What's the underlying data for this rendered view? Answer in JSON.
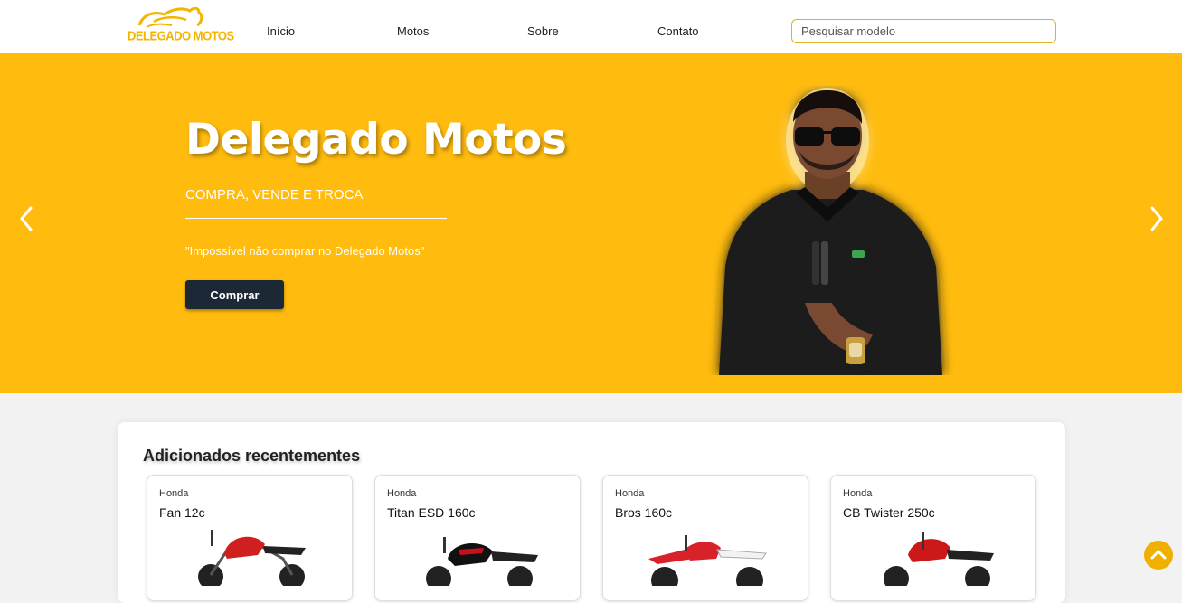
{
  "brand": {
    "logo_text": "DELEGADO MOTOS",
    "accent": "#ffbb0e",
    "dark": "#1d2837"
  },
  "nav": {
    "items": [
      {
        "label": "Início"
      },
      {
        "label": "Motos"
      },
      {
        "label": "Sobre"
      },
      {
        "label": "Contato"
      }
    ],
    "search_placeholder": "Pesquisar modelo"
  },
  "hero": {
    "title": "Delegado Motos",
    "subtitle": "COMPRA, VENDE E TROCA",
    "quote": "\"Impossível não comprar no Delegado Motos\"",
    "button_label": "Comprar",
    "prev_icon": "chevron-left-icon",
    "next_icon": "chevron-right-icon"
  },
  "recent": {
    "title": "Adicionados recentementes",
    "cards": [
      {
        "brand": "Honda",
        "model": "Fan 12c",
        "color": "#d01f1f"
      },
      {
        "brand": "Honda",
        "model": "Titan ESD 160c",
        "color": "#c8101c"
      },
      {
        "brand": "Honda",
        "model": "Bros 160c",
        "color": "#d8222a"
      },
      {
        "brand": "Honda",
        "model": "CB Twister 250c",
        "color": "#cc1818"
      }
    ]
  },
  "scroll_top_icon": "chevron-up-icon"
}
